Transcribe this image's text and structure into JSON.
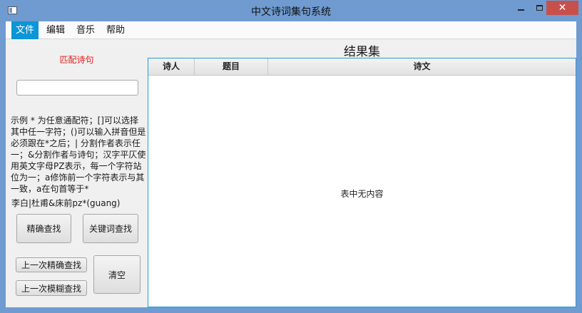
{
  "window": {
    "title": "中文诗词集句系统",
    "close_glyph": "✕"
  },
  "menu": {
    "items": [
      {
        "label": "文件",
        "active": true
      },
      {
        "label": "编辑",
        "active": false
      },
      {
        "label": "音乐",
        "active": false
      },
      {
        "label": "帮助",
        "active": false
      }
    ]
  },
  "left_panel": {
    "match_label": "匹配诗句",
    "search_input": {
      "value": "",
      "placeholder": ""
    },
    "hint_text": "示例 * 为任意通配符；[]可以选择其中任一字符；()可以输入拼音但是必须跟在*之后；| 分割作者表示任一；&分割作者与诗句；汉字平仄使用英文字母PZ表示，每一个字符站位为一；a修饰前一个字符表示与其一致，a在句首等于*",
    "example_text": "李白|杜甫&床前pz*(guang)",
    "buttons": {
      "exact": "精确查找",
      "keyword": "关键词查找",
      "last_exact": "上一次精确查找",
      "last_fuzzy": "上一次模糊查找",
      "clear": "清空"
    }
  },
  "results": {
    "title": "结果集",
    "columns": [
      "诗人",
      "题目",
      "诗文"
    ],
    "empty_text": "表中无内容"
  },
  "colors": {
    "window_frame": "#6f9bd1",
    "menu_active": "#0d95d6",
    "match_label": "#e21b1b",
    "close_button": "#c7504b",
    "table_border": "#2b9ad8"
  }
}
